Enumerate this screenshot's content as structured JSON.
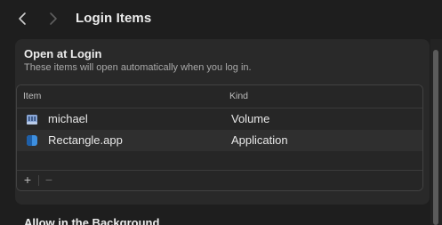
{
  "window": {
    "title": "Login Items"
  },
  "open_at_login": {
    "title": "Open at Login",
    "description": "These items will open automatically when you log in.",
    "columns": {
      "item": "Item",
      "kind": "Kind"
    },
    "rows": [
      {
        "name": "michael",
        "kind": "Volume",
        "icon": "volume-icon"
      },
      {
        "name": "Rectangle.app",
        "kind": "Application",
        "icon": "rectangle-app-icon"
      }
    ],
    "footer": {
      "add_label": "+",
      "remove_label": "−"
    }
  },
  "background_section": {
    "title": "Allow in the Background"
  },
  "colors": {
    "background": "#1e1e1e",
    "panel": "#292929",
    "selected_row": "#2f2f2f",
    "volume_icon": "#8aa7d6",
    "rectangle_icon": "#3d8fe0"
  }
}
